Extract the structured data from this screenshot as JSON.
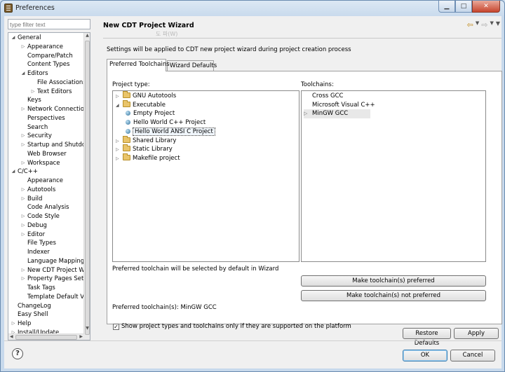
{
  "window": {
    "title": "Preferences",
    "buttons": {
      "minimize": "▁",
      "maximize": "□",
      "close": "✕"
    }
  },
  "filter": {
    "placeholder": "type filter text"
  },
  "tree": [
    {
      "label": "General",
      "level": 0,
      "state": "expanded"
    },
    {
      "label": "Appearance",
      "level": 1,
      "state": "collapsed"
    },
    {
      "label": "Compare/Patch",
      "level": 1,
      "state": "leaf"
    },
    {
      "label": "Content Types",
      "level": 1,
      "state": "leaf"
    },
    {
      "label": "Editors",
      "level": 1,
      "state": "expanded"
    },
    {
      "label": "File Associations",
      "level": 2,
      "state": "leaf"
    },
    {
      "label": "Text Editors",
      "level": 2,
      "state": "collapsed"
    },
    {
      "label": "Keys",
      "level": 1,
      "state": "leaf"
    },
    {
      "label": "Network Connections",
      "level": 1,
      "state": "collapsed"
    },
    {
      "label": "Perspectives",
      "level": 1,
      "state": "leaf"
    },
    {
      "label": "Search",
      "level": 1,
      "state": "leaf"
    },
    {
      "label": "Security",
      "level": 1,
      "state": "collapsed"
    },
    {
      "label": "Startup and Shutdown",
      "level": 1,
      "state": "collapsed"
    },
    {
      "label": "Web Browser",
      "level": 1,
      "state": "leaf"
    },
    {
      "label": "Workspace",
      "level": 1,
      "state": "collapsed"
    },
    {
      "label": "C/C++",
      "level": 0,
      "state": "expanded"
    },
    {
      "label": "Appearance",
      "level": 1,
      "state": "leaf"
    },
    {
      "label": "Autotools",
      "level": 1,
      "state": "collapsed"
    },
    {
      "label": "Build",
      "level": 1,
      "state": "collapsed"
    },
    {
      "label": "Code Analysis",
      "level": 1,
      "state": "leaf"
    },
    {
      "label": "Code Style",
      "level": 1,
      "state": "collapsed"
    },
    {
      "label": "Debug",
      "level": 1,
      "state": "collapsed"
    },
    {
      "label": "Editor",
      "level": 1,
      "state": "collapsed"
    },
    {
      "label": "File Types",
      "level": 1,
      "state": "leaf"
    },
    {
      "label": "Indexer",
      "level": 1,
      "state": "leaf"
    },
    {
      "label": "Language Mappings",
      "level": 1,
      "state": "leaf"
    },
    {
      "label": "New CDT Project Wizard",
      "level": 1,
      "state": "collapsed"
    },
    {
      "label": "Property Pages Settings",
      "level": 1,
      "state": "collapsed"
    },
    {
      "label": "Task Tags",
      "level": 1,
      "state": "leaf"
    },
    {
      "label": "Template Default Values",
      "level": 1,
      "state": "leaf"
    },
    {
      "label": "ChangeLog",
      "level": 0,
      "state": "leaf"
    },
    {
      "label": "Easy Shell",
      "level": 0,
      "state": "leaf"
    },
    {
      "label": "Help",
      "level": 0,
      "state": "collapsed"
    },
    {
      "label": "Install/Update",
      "level": 0,
      "state": "collapsed"
    }
  ],
  "page": {
    "title": "New CDT Project Wizard",
    "ghost_text": "도 파(W)",
    "description": "Settings will be applied to CDT new project wizard during project creation process",
    "tabs": [
      "Preferred Toolchains",
      "Wizard Defaults"
    ],
    "project_type_label": "Project type:",
    "toolchains_label": "Toolchains:",
    "project_types": [
      {
        "label": "GNU Autotools",
        "level": 0,
        "kind": "folder",
        "state": "collapsed"
      },
      {
        "label": "Executable",
        "level": 0,
        "kind": "folder",
        "state": "expanded"
      },
      {
        "label": "Empty Project",
        "level": 1,
        "kind": "item",
        "state": "leaf"
      },
      {
        "label": "Hello World C++ Project",
        "level": 1,
        "kind": "item",
        "state": "leaf"
      },
      {
        "label": "Hello World ANSI C Project",
        "level": 1,
        "kind": "item",
        "state": "leaf",
        "selected": true
      },
      {
        "label": "Shared Library",
        "level": 0,
        "kind": "folder",
        "state": "collapsed"
      },
      {
        "label": "Static Library",
        "level": 0,
        "kind": "folder",
        "state": "collapsed"
      },
      {
        "label": "Makefile project",
        "level": 0,
        "kind": "folder",
        "state": "collapsed"
      }
    ],
    "toolchains": [
      {
        "label": "Cross GCC",
        "preferred": false
      },
      {
        "label": "Microsoft Visual C++",
        "preferred": false
      },
      {
        "label": "MinGW GCC",
        "preferred": true
      }
    ],
    "hint": "Preferred toolchain will be selected by default in Wizard",
    "make_preferred": "Make toolchain(s) preferred",
    "make_not_preferred": "Make toolchain(s) not preferred",
    "preferred_toolchains": "Preferred toolchain(s): MinGW GCC",
    "checkbox_label": "Show project types and toolchains only if they are supported on the platform",
    "checkbox_checked": true,
    "restore_defaults": "Restore Defaults",
    "apply": "Apply"
  },
  "footer": {
    "ok": "OK",
    "cancel": "Cancel",
    "help": "?"
  }
}
